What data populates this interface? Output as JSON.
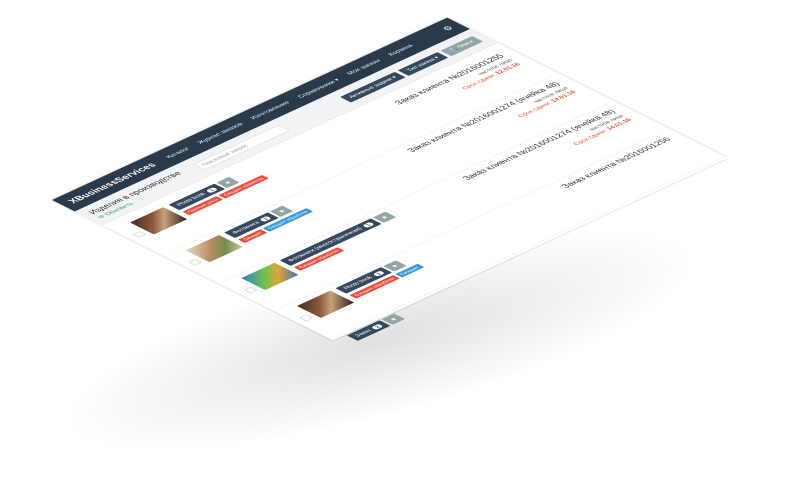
{
  "app": {
    "brand": "XBusinessServices",
    "nav": [
      "Каталог",
      "Журнал заказов",
      "Изготовление",
      "Справочники ▾",
      "Мои заказы",
      "Корзина"
    ]
  },
  "toolbar": {
    "title": "Изделия в производстве",
    "refresh": "⟳ Обновить",
    "search_placeholder": "Поисковый запрос",
    "btn_active": "Активные задачи ▾",
    "btn_type": "Тип заказа ▾",
    "btn_search": "🔍 Поиск"
  },
  "rows": [
    {
      "product": "Photo book",
      "count": "1",
      "tags": [
        "Срочный заказ",
        "Ожидает обработки"
      ],
      "order": "Заказ клиента №2016001255",
      "client": "частное лицо",
      "deadline_label": "Срок сдачи:",
      "deadline": "12.01.16"
    },
    {
      "product": "Фотокнига",
      "count": "1",
      "tags": [
        "Ожидает",
        "Ожидает обработки"
      ],
      "order": "Заказ клиента №2016001274 (ячейка 48)",
      "client": "частное лицо",
      "deadline_label": "Срок сдачи:",
      "deadline": "14.01.16"
    },
    {
      "product": "Фотокниги (многостраничная)",
      "count": "1",
      "tags": [
        "Ожидает обработки"
      ],
      "order": "Заказ клиента №2016001274 (ячейка 48)",
      "client": "частное лицо",
      "deadline_label": "Срок сдачи:",
      "deadline": "14.01.16"
    },
    {
      "product": "Photo book",
      "count": "1",
      "tags": [
        "Ожидает обработки",
        "Ожидает"
      ],
      "order": "Заказ клиента №2016001256",
      "client": "",
      "deadline_label": "",
      "deadline": ""
    }
  ],
  "footer": {
    "label": "Заказ",
    "count": "2"
  }
}
